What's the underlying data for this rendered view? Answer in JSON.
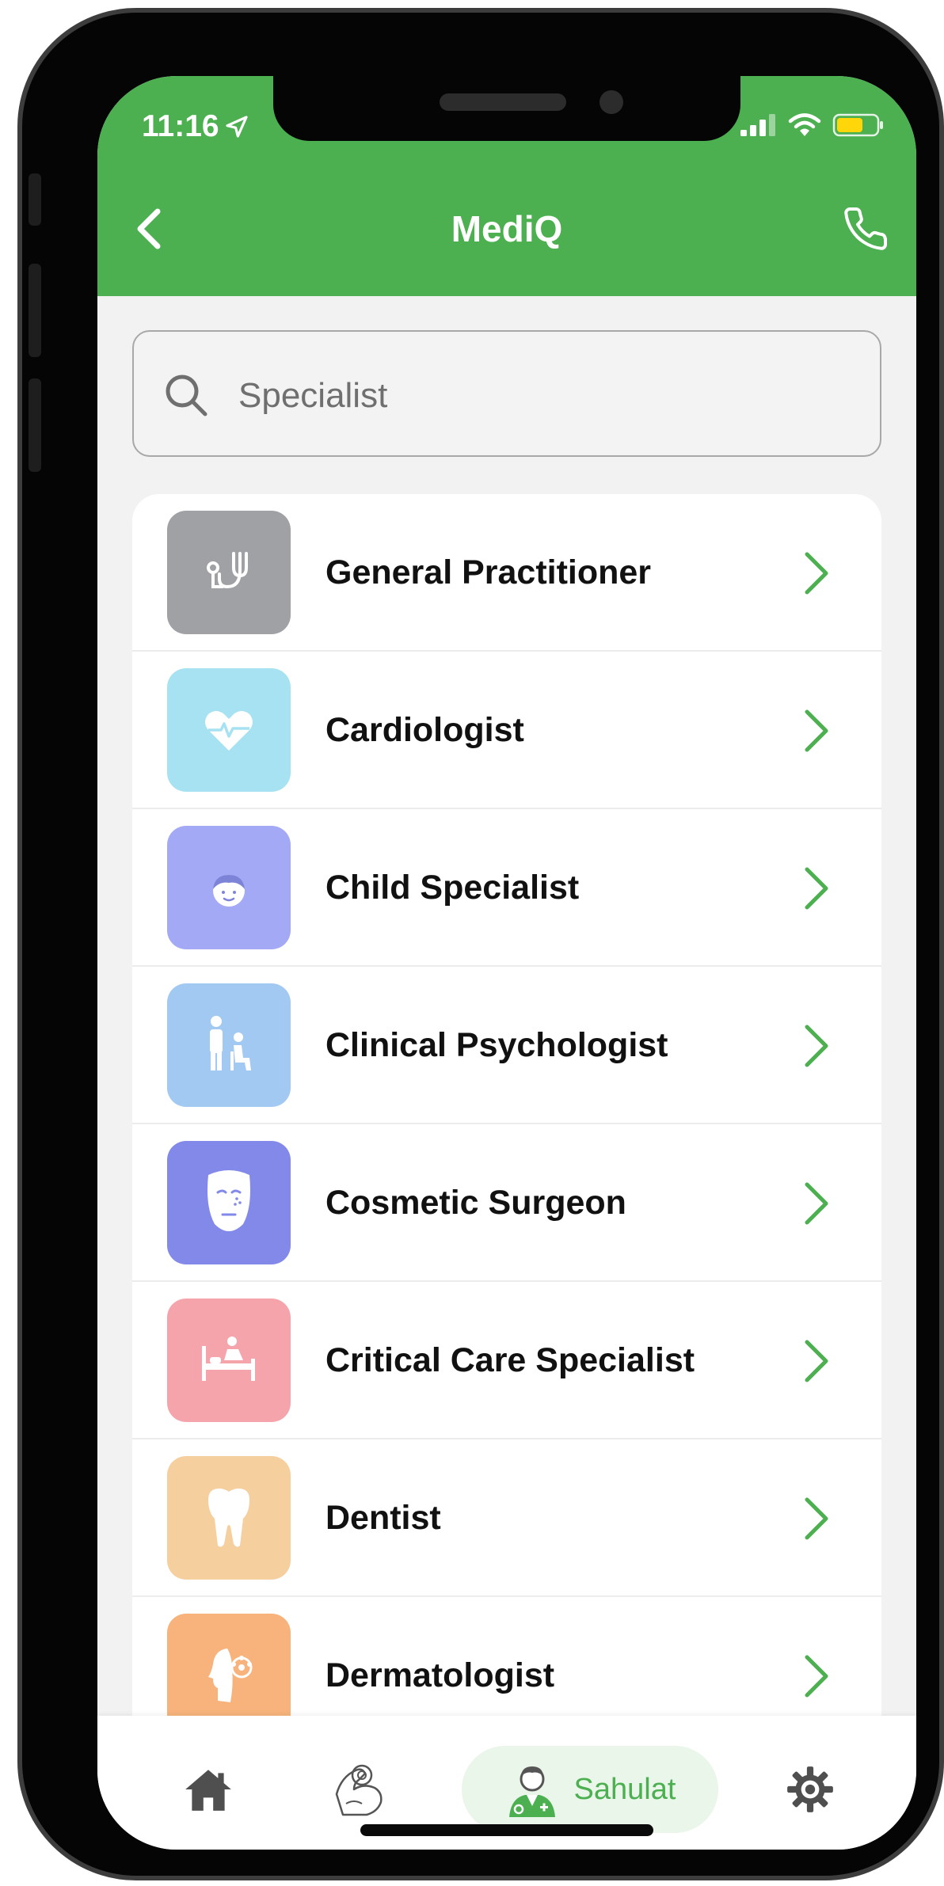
{
  "status_bar": {
    "time": "11:16"
  },
  "header": {
    "title": "MediQ",
    "background_color": "#4caf50"
  },
  "search": {
    "placeholder": "Specialist",
    "value": ""
  },
  "specialists": [
    {
      "label": "General Practitioner",
      "icon": "stethoscope-icon",
      "color": "#a0a1a4"
    },
    {
      "label": "Cardiologist",
      "icon": "heart-pulse-icon",
      "color": "#a6e2f1"
    },
    {
      "label": "Child Specialist",
      "icon": "child-face-icon",
      "color": "#a3a9f5"
    },
    {
      "label": "Clinical Psychologist",
      "icon": "patient-consult-icon",
      "color": "#a2c9f2"
    },
    {
      "label": "Cosmetic Surgeon",
      "icon": "face-mask-icon",
      "color": "#8289e8"
    },
    {
      "label": "Critical Care Specialist",
      "icon": "hospital-bed-icon",
      "color": "#f4a4aa"
    },
    {
      "label": "Dentist",
      "icon": "tooth-icon",
      "color": "#f6cf9f"
    },
    {
      "label": "Dermatologist",
      "icon": "skin-profile-icon",
      "color": "#f7b37b"
    }
  ],
  "bottom_nav": {
    "items": [
      {
        "name": "home",
        "icon": "home-icon"
      },
      {
        "name": "fitness",
        "icon": "muscle-arm-icon"
      },
      {
        "name": "sahulat",
        "icon": "doctor-icon",
        "label": "Sahulat",
        "active": true
      },
      {
        "name": "settings",
        "icon": "gear-icon"
      }
    ]
  }
}
